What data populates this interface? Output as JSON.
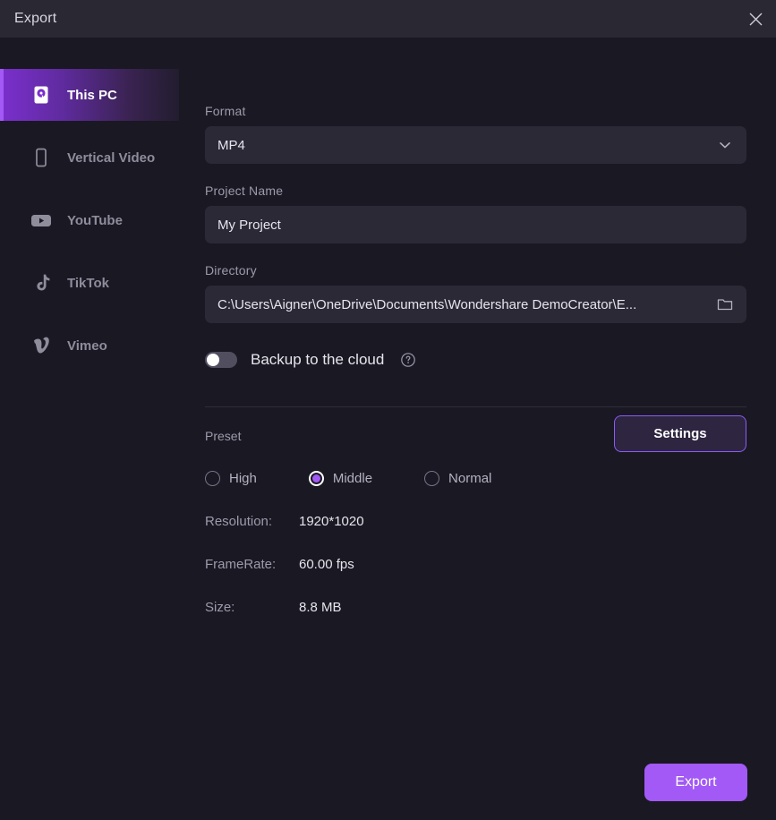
{
  "window": {
    "title": "Export",
    "close_icon": "close-icon"
  },
  "sidebar": {
    "items": [
      {
        "label": "This PC",
        "icon": "hard-drive-icon",
        "active": true
      },
      {
        "label": "Vertical Video",
        "icon": "smartphone-icon",
        "active": false
      },
      {
        "label": "YouTube",
        "icon": "youtube-icon",
        "active": false
      },
      {
        "label": "TikTok",
        "icon": "tiktok-icon",
        "active": false
      },
      {
        "label": "Vimeo",
        "icon": "vimeo-icon",
        "active": false
      }
    ]
  },
  "form": {
    "format": {
      "label": "Format",
      "value": "MP4",
      "icon": "chevron-down-icon"
    },
    "project_name": {
      "label": "Project Name",
      "value": "My Project",
      "placeholder": "My Project"
    },
    "directory": {
      "label": "Directory",
      "value": "C:\\Users\\Aigner\\OneDrive\\Documents\\Wondershare DemoCreator\\E...",
      "icon": "folder-icon"
    },
    "backup": {
      "label": "Backup to the cloud",
      "enabled": false,
      "help_icon": "question-circle-icon"
    }
  },
  "preset": {
    "label": "Preset",
    "settings_label": "Settings",
    "options": [
      {
        "label": "High",
        "selected": false
      },
      {
        "label": "Middle",
        "selected": true
      },
      {
        "label": "Normal",
        "selected": false
      }
    ],
    "info": [
      {
        "key": "Resolution:",
        "value": "1920*1020"
      },
      {
        "key": "FrameRate:",
        "value": "60.00 fps"
      },
      {
        "key": "Size:",
        "value": "8.8 MB"
      }
    ]
  },
  "footer": {
    "export_label": "Export"
  },
  "colors": {
    "accent": "#a259f5",
    "window_bg": "#1a1822",
    "titlebar_bg": "#2a2833",
    "input_bg": "#2b2936"
  }
}
